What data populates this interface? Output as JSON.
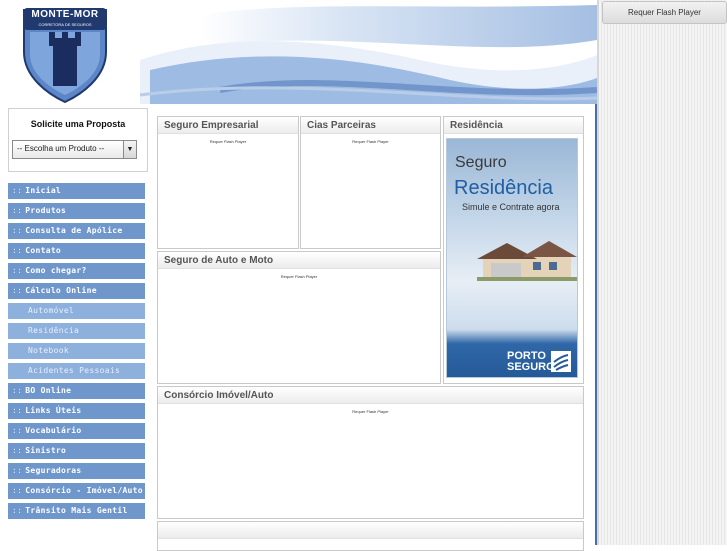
{
  "header": {
    "logo_top_text": "MONTE-MOR",
    "logo_bottom_text": "CORRETORA DE SEGUROS"
  },
  "flash_button": "Requer Flash Player",
  "proposal": {
    "title": "Solicite uma Proposta",
    "select_value": "-- Escolha um Produto --"
  },
  "nav": {
    "bullet": "::",
    "items": [
      {
        "label": "Inicial",
        "type": "main"
      },
      {
        "label": "Produtos",
        "type": "main"
      },
      {
        "label": "Consulta de Apólice",
        "type": "main"
      },
      {
        "label": "Contato",
        "type": "main"
      },
      {
        "label": "Como chegar?",
        "type": "main"
      },
      {
        "label": "Cálculo Online",
        "type": "main"
      },
      {
        "label": "Automóvel",
        "type": "sub"
      },
      {
        "label": "Residência",
        "type": "sub"
      },
      {
        "label": "Notebook",
        "type": "sub"
      },
      {
        "label": "Acidentes Pessoais",
        "type": "sub"
      },
      {
        "label": "BO Online",
        "type": "main"
      },
      {
        "label": "Links Úteis",
        "type": "main"
      },
      {
        "label": "Vocabulário",
        "type": "main"
      },
      {
        "label": "Sinistro",
        "type": "main"
      },
      {
        "label": "Seguradoras",
        "type": "main"
      },
      {
        "label": "Consórcio - Imóvel/Auto",
        "type": "main"
      },
      {
        "label": "Trânsito Mais Gentil",
        "type": "main"
      }
    ]
  },
  "panels": {
    "seguro_empresarial": {
      "title": "Seguro Empresarial",
      "flash": "Requer Flash Player"
    },
    "cias_parceiras": {
      "title": "Cias Parceiras",
      "flash": "Requer Flash Player"
    },
    "residencia": {
      "title": "Residência"
    },
    "seguro_auto_moto": {
      "title": "Seguro de Auto e Moto",
      "flash": "Requer Flash Player"
    },
    "consorcio": {
      "title": "Consórcio Imóvel/Auto",
      "flash": "Requer Flash Player"
    }
  },
  "ad": {
    "line1": "Seguro",
    "line2": "Residência",
    "line3": "Simule e Contrate agora",
    "brand_line1": "PORTO",
    "brand_line2": "SEGURO"
  },
  "colors": {
    "nav_main": "#6f97cc",
    "nav_sub": "#8eb0dd",
    "brand_blue": "#1f5fa3"
  }
}
